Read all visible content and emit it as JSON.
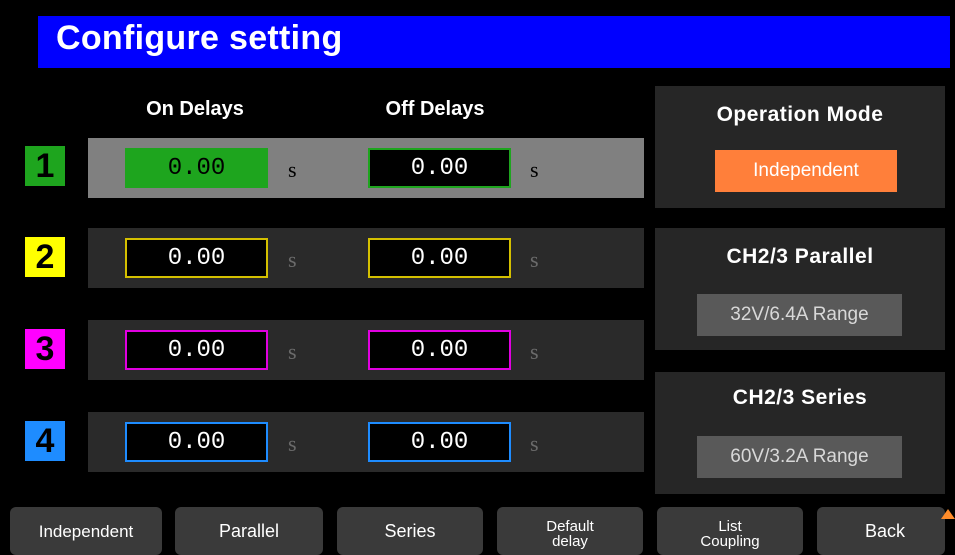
{
  "title": "Configure setting",
  "headers": {
    "on": "On Delays",
    "off": "Off Delays"
  },
  "channels": [
    {
      "num": "1",
      "color": "#1ea51e",
      "on": "0.00",
      "off": "0.00",
      "unit": "s"
    },
    {
      "num": "2",
      "color": "#ffff00",
      "on": "0.00",
      "off": "0.00",
      "unit": "s"
    },
    {
      "num": "3",
      "color": "#ff00ff",
      "on": "0.00",
      "off": "0.00",
      "unit": "s"
    },
    {
      "num": "4",
      "color": "#1e8cff",
      "on": "0.00",
      "off": "0.00",
      "unit": "s"
    }
  ],
  "panels": {
    "mode": {
      "title": "Operation  Mode",
      "value": "Independent",
      "color": "#ff7f3a"
    },
    "parallel": {
      "title": "CH2/3  Parallel",
      "value": "32V/6.4A Range"
    },
    "series": {
      "title": "CH2/3  Series",
      "value": "60V/3.2A Range"
    }
  },
  "softkeys": [
    "Independent",
    "Parallel",
    "Series",
    "Default delay",
    "List Coupling",
    "Back"
  ],
  "softkey_lines": {
    "default_1": "Default",
    "default_2": "delay",
    "list_1": "List",
    "list_2": "Coupling"
  }
}
